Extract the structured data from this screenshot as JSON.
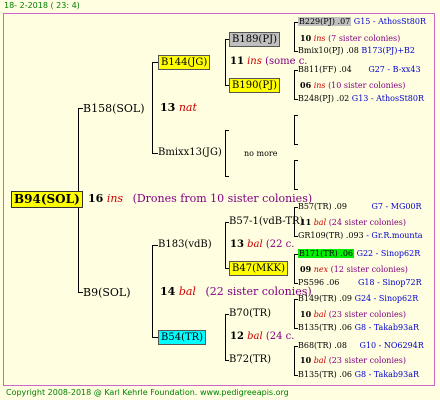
{
  "header": {
    "date": "18-  2-2018 ( 23: 4)"
  },
  "footer": {
    "copyright": "Copyright 2008-2018 @ Karl Kehrle Foundation.   www.pedigreeapis.org"
  },
  "root": {
    "name": "B94(SOL)",
    "num": "16",
    "ins": "ins",
    "sis": "(Drones from 10 sister colonies)"
  },
  "g1": [
    {
      "name": "B158(SOL)",
      "num": "13",
      "ins": "nat"
    },
    {
      "name": "B9(SOL)",
      "num": "14",
      "ins": "bal",
      "sis": "(22 sister colonies)"
    }
  ],
  "g2": [
    {
      "name": "B144(JG)",
      "num": "11",
      "ins": "ins",
      "sis": "(some c."
    },
    {
      "name": "Bmixx13(JG)",
      "nomore": "no more"
    },
    {
      "name": "B183(vdB)",
      "num": "13",
      "ins": "bal",
      "sis": "(22 c."
    },
    {
      "name": "B54(TR)",
      "num": "12",
      "ins": "bal",
      "sis": "(24 c."
    }
  ],
  "g3": [
    {
      "name": "B189(PJ)",
      "num": "10",
      "ins": "ins",
      "sis": "(7 sister colonies)"
    },
    {
      "name": "B190(PJ)",
      "num": "06",
      "ins": "ins",
      "sis": "(10 sister colonies)"
    },
    {
      "name": "B57-1(vdB-TR)",
      "num": "11",
      "ins": "bal",
      "sis": "(24 sister colonies)"
    },
    {
      "name": "B47(MKK)",
      "num": "09",
      "ins": "nex",
      "sis": "(12 sister colonies)"
    },
    {
      "name": "B70(TR)",
      "num": "10",
      "ins": "bal",
      "sis": "(23 sister colonies)"
    },
    {
      "name": "B72(TR)",
      "num": "10",
      "ins": "bal",
      "sis": "(23 sister colonies)"
    }
  ],
  "g4": [
    {
      "left": "B229(PJ) .07",
      "right": "G15 - AthosSt80R"
    },
    {
      "left": "Bmix10(PJ) .08",
      "right": "B173(PJ)+B2"
    },
    {
      "left": "B811(FF) .04",
      "right": "G27 - B-xx43"
    },
    {
      "left": "B248(PJ) .02",
      "right": "G13 - AthosSt80R"
    },
    {
      "left": "B57(TR) .09",
      "right": "G7 - MG00R"
    },
    {
      "left": "GR109(TR) .093",
      "right": "- Gr.R.mounta"
    },
    {
      "left": "B171(TR) .06",
      "right": "G22 - Sinop62R"
    },
    {
      "left": "PS596 .06",
      "right": "G18 - Sinop72R"
    },
    {
      "left": "B149(TR) .09",
      "right": "G24 - Sinop62R"
    },
    {
      "left": "B135(TR) .06",
      "right": "G8 - Takab93aR"
    },
    {
      "left": "B68(TR) .08",
      "right": "G10 - NO6294R"
    },
    {
      "left": "B135(TR) .06",
      "right": "G8 - Takab93aR"
    }
  ]
}
